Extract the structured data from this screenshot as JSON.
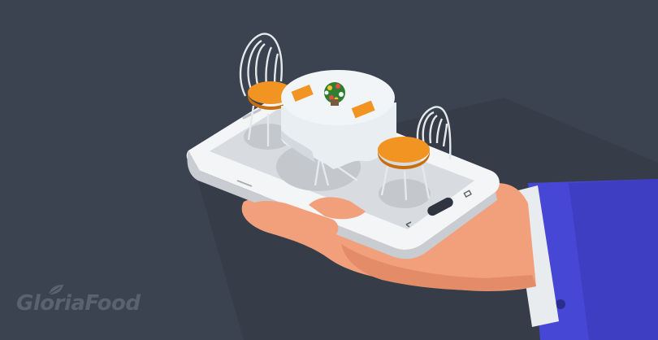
{
  "brand": {
    "name": "GloriaFood"
  },
  "icons": {
    "logo_leaf": "leaf-icon",
    "home_button": "home-button-icon",
    "back_button": "back-icon",
    "recent_button": "recent-apps-icon"
  },
  "colors": {
    "background": "#3b4350",
    "sleeve": "#4747d6",
    "cuff": "#e9ecef",
    "skin": "#f2a07b",
    "phone_body": "#f4f5f6",
    "phone_screen": "#d8dbdf",
    "cushion": "#f29422",
    "tablecloth": "#e9eef2",
    "logo": "#5a626e"
  }
}
